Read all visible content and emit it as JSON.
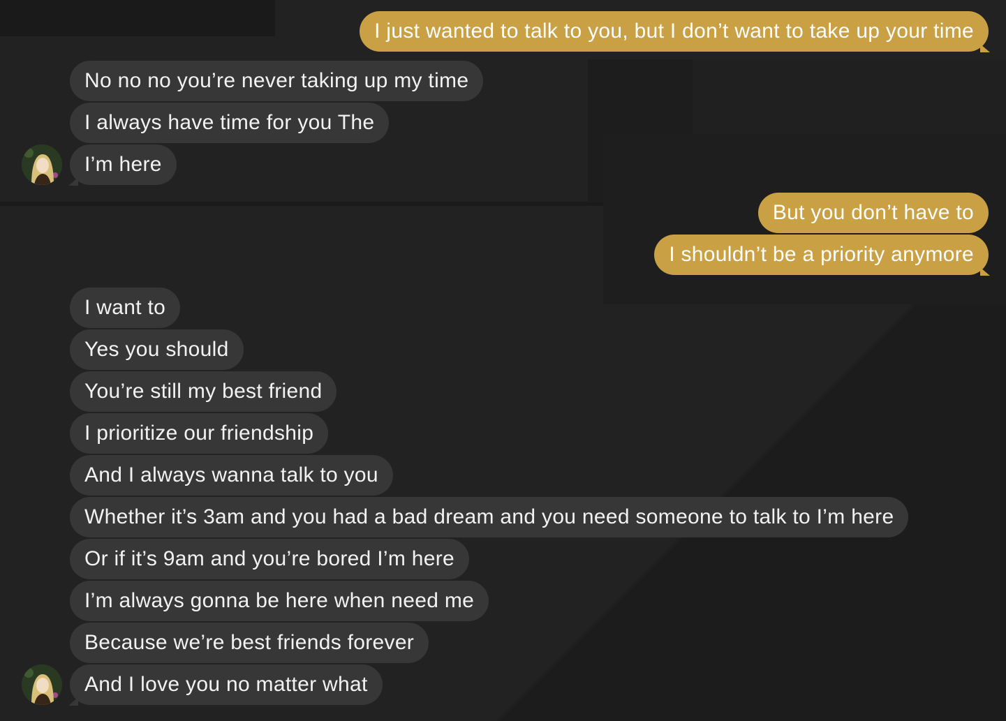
{
  "conversation": {
    "messages": [
      {
        "from": "me",
        "text": "I just wanted to talk to you, but I don’t want to take up your time"
      },
      {
        "from": "them",
        "text": "No no no you’re never taking up my time"
      },
      {
        "from": "them",
        "text": "I always have time for you The"
      },
      {
        "from": "them",
        "text": "I’m here"
      },
      {
        "from": "me",
        "text": "But you don’t have to"
      },
      {
        "from": "me",
        "text": "I shouldn’t be a priority anymore"
      },
      {
        "from": "them",
        "text": "I want to"
      },
      {
        "from": "them",
        "text": "Yes you should"
      },
      {
        "from": "them",
        "text": "You’re still my best friend"
      },
      {
        "from": "them",
        "text": "I prioritize our friendship"
      },
      {
        "from": "them",
        "text": "And I always wanna talk to you"
      },
      {
        "from": "them",
        "text": "Whether it’s 3am and you had a bad dream and you need someone to talk to I’m here"
      },
      {
        "from": "them",
        "text": "Or if it’s 9am and you’re bored I’m here"
      },
      {
        "from": "them",
        "text": "I’m always gonna be here when need me"
      },
      {
        "from": "them",
        "text": "Because we’re best friends forever"
      },
      {
        "from": "them",
        "text": "And I love you no matter what"
      }
    ]
  },
  "colors": {
    "background": "#222223",
    "sent_bubble": "#c9a044",
    "received_bubble": "#373738",
    "text": "#f2f2f2"
  },
  "icons": {
    "avatar": "contact-avatar-icon"
  }
}
